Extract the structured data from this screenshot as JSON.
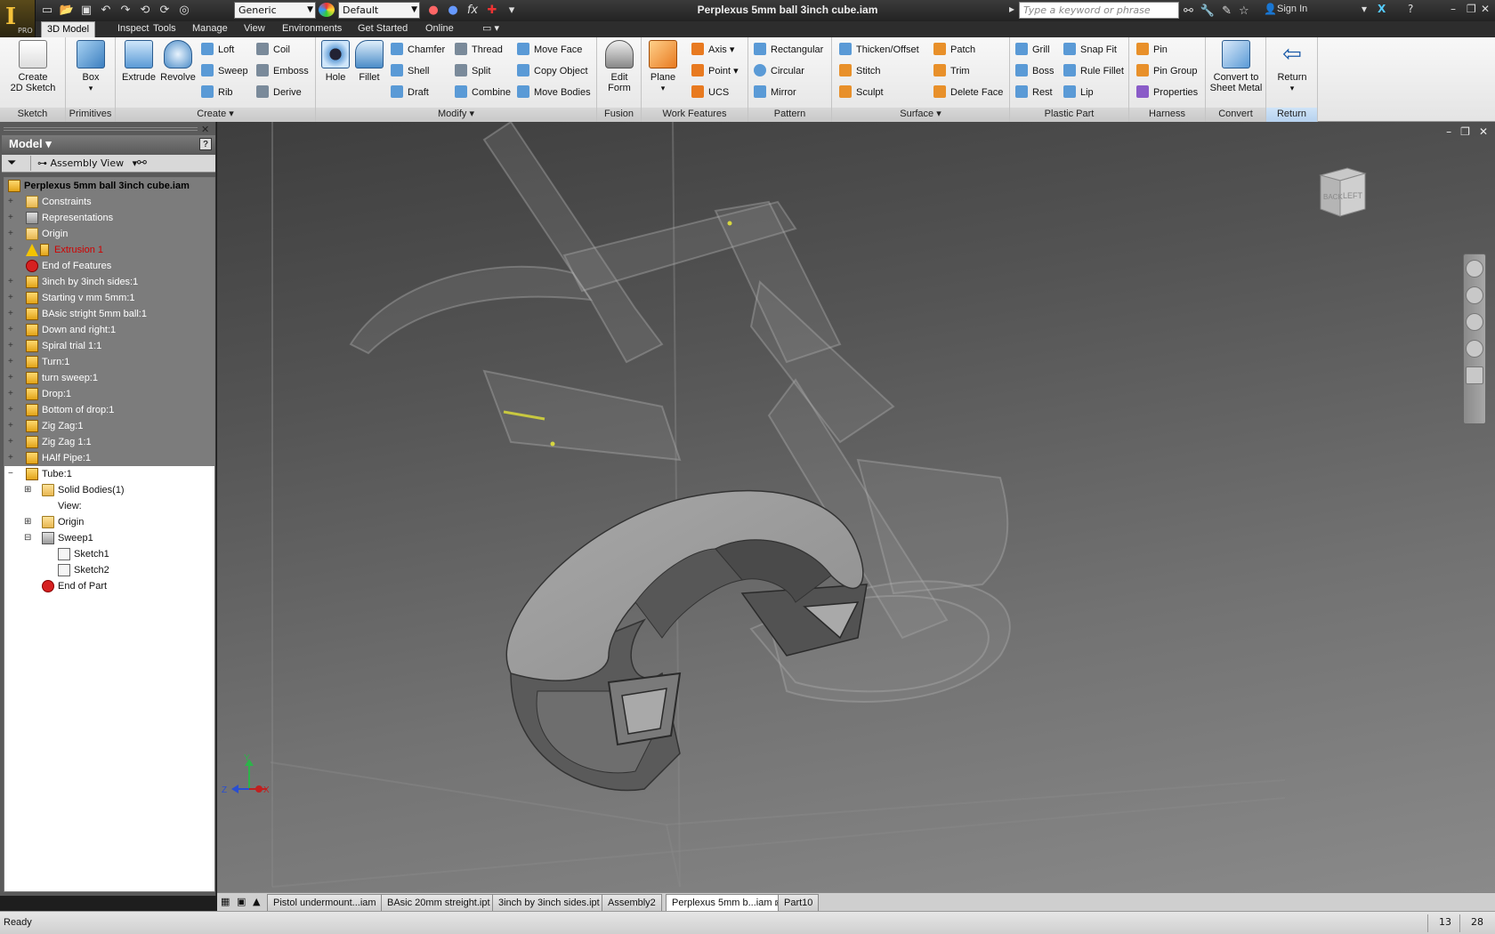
{
  "titlebar": {
    "document_title": "Perplexus 5mm ball 3inch cube.iam",
    "material_combo": "Generic",
    "appearance_combo": "Default",
    "search_placeholder": "Type a keyword or phrase",
    "sign_in": "Sign In",
    "app_badge": "PRO"
  },
  "menu_tabs": [
    "3D Model",
    "Inspect",
    "Tools",
    "Manage",
    "View",
    "Environments",
    "Get Started",
    "Online"
  ],
  "ribbon": {
    "sketch": {
      "label": "Sketch",
      "create_2d_sketch": "Create\n2D Sketch"
    },
    "primitives": {
      "label": "Primitives",
      "box": "Box"
    },
    "create": {
      "label": "Create",
      "extrude": "Extrude",
      "revolve": "Revolve",
      "loft": "Loft",
      "sweep": "Sweep",
      "rib": "Rib",
      "coil": "Coil",
      "emboss": "Emboss",
      "derive": "Derive"
    },
    "modify": {
      "label": "Modify",
      "hole": "Hole",
      "fillet": "Fillet",
      "chamfer": "Chamfer",
      "shell": "Shell",
      "draft": "Draft",
      "thread": "Thread",
      "split": "Split",
      "combine": "Combine",
      "move_face": "Move Face",
      "copy_object": "Copy Object",
      "move_bodies": "Move Bodies"
    },
    "fusion": {
      "label": "Fusion",
      "edit_form": "Edit\nForm"
    },
    "work_features": {
      "label": "Work Features",
      "plane": "Plane",
      "axis": "Axis",
      "point": "Point",
      "ucs": "UCS"
    },
    "pattern": {
      "label": "Pattern",
      "rectangular": "Rectangular",
      "circular": "Circular",
      "mirror": "Mirror"
    },
    "surface": {
      "label": "Surface",
      "thicken_offset": "Thicken/Offset",
      "stitch": "Stitch",
      "sculpt": "Sculpt",
      "patch": "Patch",
      "trim": "Trim",
      "delete_face": "Delete Face"
    },
    "plastic_part": {
      "label": "Plastic Part",
      "grill": "Grill",
      "boss": "Boss",
      "rest": "Rest",
      "snap_fit": "Snap Fit",
      "rule_fillet": "Rule Fillet",
      "lip": "Lip"
    },
    "harness": {
      "label": "Harness",
      "pin": "Pin",
      "pin_group": "Pin Group",
      "properties": "Properties"
    },
    "convert": {
      "label": "Convert",
      "convert_to_sheet_metal": "Convert to\nSheet Metal"
    },
    "return": {
      "label": "Return",
      "return": "Return"
    }
  },
  "browser": {
    "title": "Model",
    "view_combo": "Assembly View",
    "root": "Perplexus 5mm ball 3inch cube.iam",
    "items": [
      {
        "label": "Constraints",
        "icon": "folder-icon"
      },
      {
        "label": "Representations",
        "icon": "representations-icon"
      },
      {
        "label": "Origin",
        "icon": "folder-icon"
      },
      {
        "label": "Extrusion 1",
        "icon": "warning-icon",
        "status": "error"
      },
      {
        "label": "End of Features",
        "icon": "end-of-features-icon"
      },
      {
        "label": "3inch by 3inch sides:1",
        "icon": "part-icon"
      },
      {
        "label": "Starting v mm 5mm:1",
        "icon": "part-icon"
      },
      {
        "label": "BAsic stright 5mm ball:1",
        "icon": "part-icon"
      },
      {
        "label": "Down and right:1",
        "icon": "part-icon"
      },
      {
        "label": "Spiral trial 1:1",
        "icon": "part-icon"
      },
      {
        "label": "Turn:1",
        "icon": "part-icon"
      },
      {
        "label": "turn sweep:1",
        "icon": "part-icon"
      },
      {
        "label": "Drop:1",
        "icon": "part-icon"
      },
      {
        "label": "Bottom of drop:1",
        "icon": "part-icon"
      },
      {
        "label": "Zig Zag:1",
        "icon": "part-icon"
      },
      {
        "label": "Zig Zag 1:1",
        "icon": "part-icon"
      },
      {
        "label": "HAlf Pipe:1",
        "icon": "part-icon"
      }
    ],
    "edited_part": {
      "label": "Tube:1",
      "children": [
        {
          "label": "Solid Bodies(1)",
          "icon": "folder-icon"
        },
        {
          "label": "View:",
          "icon": "none"
        },
        {
          "label": "Origin",
          "icon": "folder-icon"
        },
        {
          "label": "Sweep1",
          "icon": "sweep-icon"
        },
        {
          "label": "Sketch1",
          "icon": "sketch-icon"
        },
        {
          "label": "Sketch2",
          "icon": "sketch-icon"
        },
        {
          "label": "End of Part",
          "icon": "end-of-part-icon"
        }
      ]
    }
  },
  "viewcube": {
    "faces": [
      "BACK",
      "LEFT"
    ]
  },
  "triad": {
    "x": "X",
    "y": "Y",
    "z": "Z"
  },
  "doc_tabs": [
    {
      "label": "Pistol undermount...iam",
      "active": false
    },
    {
      "label": "BAsic 20mm streight.ipt",
      "active": false
    },
    {
      "label": "3inch by 3inch sides.ipt",
      "active": false
    },
    {
      "label": "Assembly2",
      "active": false
    },
    {
      "label": "Perplexus 5mm b...iam",
      "active": true
    },
    {
      "label": "Part10",
      "active": false
    }
  ],
  "status": {
    "text": "Ready",
    "cell1": "13",
    "cell2": "28"
  },
  "colors": {
    "accent_blue": "#b6d1ee",
    "error_red": "#d00000",
    "browser_shaded": "#7c7c7c"
  }
}
